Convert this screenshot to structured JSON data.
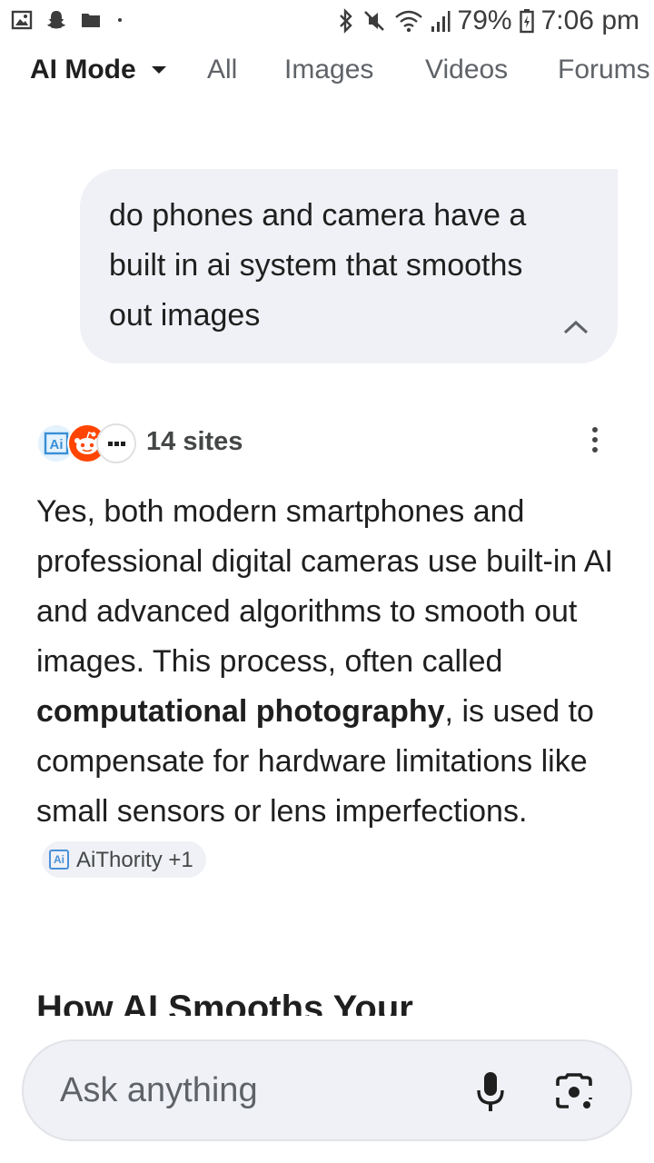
{
  "status_bar": {
    "battery": "79%",
    "time": "7:06 pm"
  },
  "tabs": [
    {
      "label": "AI Mode",
      "active": true
    },
    {
      "label": "All"
    },
    {
      "label": "Images"
    },
    {
      "label": "Videos"
    },
    {
      "label": "Forums"
    }
  ],
  "query": {
    "text": "do phones and camera have a built in ai system that smooths out images"
  },
  "sources": {
    "label": "14 sites",
    "icons": [
      "aithority-icon",
      "reddit-icon",
      "more-sites-icon"
    ]
  },
  "answer": {
    "part1": "Yes, both modern smartphones and professional digital cameras use built-in AI and advanced algorithms to smooth out images. This process, often called ",
    "bold": "computational photography",
    "part2": ", is used to compensate for hardware limitations like small sensors or lens imperfections.",
    "citation": "AiThority +1",
    "heading": "How AI Smooths Your"
  },
  "ask": {
    "placeholder": "Ask anything"
  },
  "colors": {
    "bubble_bg": "#eff1f6",
    "reddit": "#ff4500",
    "text": "#1f1f1f",
    "muted": "#5f6368"
  }
}
